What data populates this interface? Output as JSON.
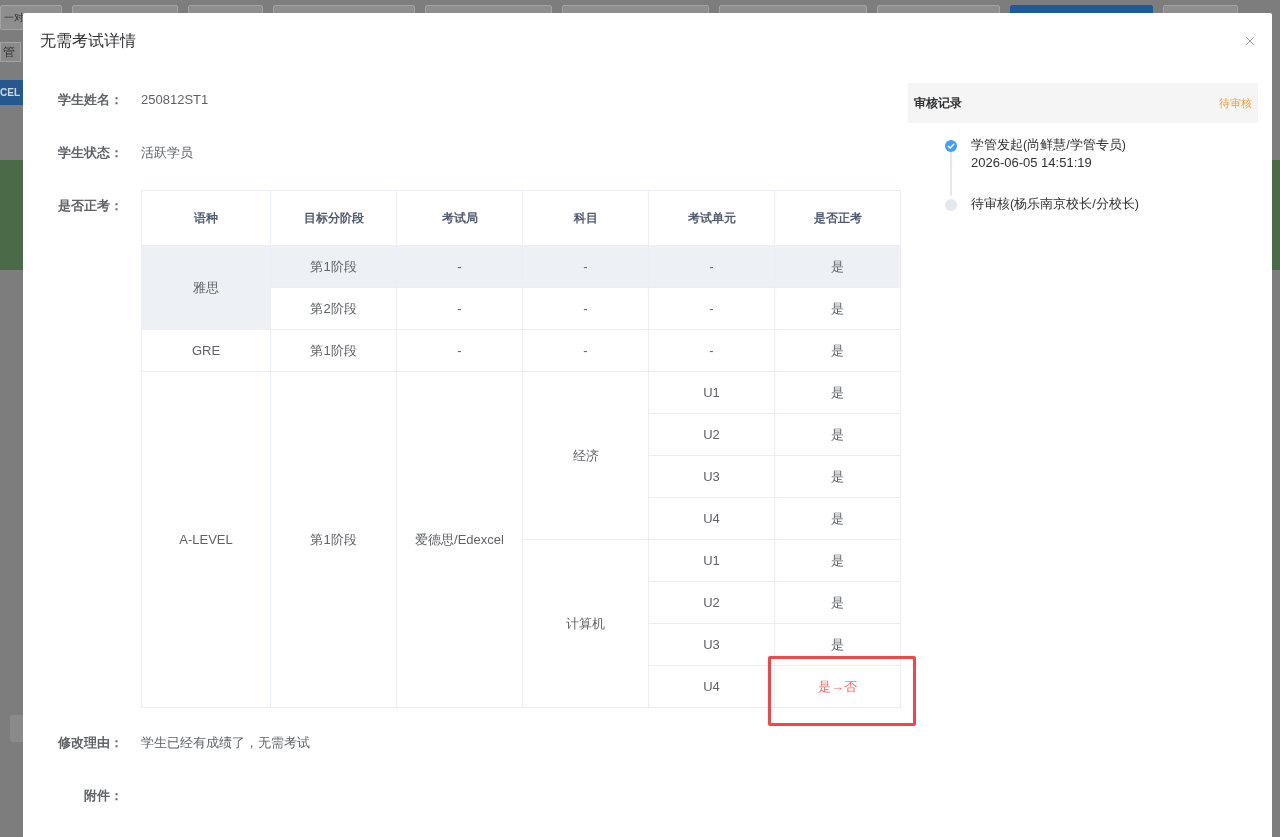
{
  "background": {
    "tabs": [
      {
        "label": "一对",
        "selected": false
      },
      {
        "selected": false
      },
      {
        "selected": false
      },
      {
        "selected": false
      },
      {
        "selected": false
      },
      {
        "selected": false
      },
      {
        "selected": false
      },
      {
        "selected": false
      },
      {
        "selected": true
      },
      {
        "selected": false
      }
    ],
    "toolbar_button": "管",
    "export_button": "CEL"
  },
  "dialog": {
    "title": "无需考试详情",
    "fields": [
      {
        "kind": "text",
        "label": "学生姓名：",
        "value": "250812ST1"
      },
      {
        "kind": "text",
        "label": "学生状态：",
        "value": "活跃学员"
      },
      {
        "kind": "table",
        "label": "是否正考：",
        "table": {
          "columns": [
            "语种",
            "目标分阶段",
            "考试局",
            "科目",
            "考试单元",
            "是否正考"
          ],
          "languages": [
            {
              "name": "雅思",
              "stages": [
                {
                  "name": "第1阶段",
                  "board": "-",
                  "subjects": [
                    {
                      "name": "-",
                      "units": [
                        {
                          "name": "-",
                          "formal": "是",
                          "hovered": true,
                          "changed": false
                        }
                      ]
                    }
                  ]
                },
                {
                  "name": "第2阶段",
                  "board": "-",
                  "subjects": [
                    {
                      "name": "-",
                      "units": [
                        {
                          "name": "-",
                          "formal": "是",
                          "hovered": false,
                          "changed": false
                        }
                      ]
                    }
                  ]
                }
              ]
            },
            {
              "name": "GRE",
              "stages": [
                {
                  "name": "第1阶段",
                  "board": "-",
                  "subjects": [
                    {
                      "name": "-",
                      "units": [
                        {
                          "name": "-",
                          "formal": "是",
                          "hovered": false,
                          "changed": false
                        }
                      ]
                    }
                  ]
                }
              ]
            },
            {
              "name": "A-LEVEL",
              "stages": [
                {
                  "name": "第1阶段",
                  "board": "爱德思/Edexcel",
                  "subjects": [
                    {
                      "name": "经济",
                      "units": [
                        {
                          "name": "U1",
                          "formal": "是",
                          "hovered": false,
                          "changed": false
                        },
                        {
                          "name": "U2",
                          "formal": "是",
                          "hovered": false,
                          "changed": false
                        },
                        {
                          "name": "U3",
                          "formal": "是",
                          "hovered": false,
                          "changed": false
                        },
                        {
                          "name": "U4",
                          "formal": "是",
                          "hovered": false,
                          "changed": false
                        }
                      ]
                    },
                    {
                      "name": "计算机",
                      "units": [
                        {
                          "name": "U1",
                          "formal": "是",
                          "hovered": false,
                          "changed": false
                        },
                        {
                          "name": "U2",
                          "formal": "是",
                          "hovered": false,
                          "changed": false
                        },
                        {
                          "name": "U3",
                          "formal": "是",
                          "hovered": false,
                          "changed": false
                        },
                        {
                          "name": "U4",
                          "formal": "是→否",
                          "hovered": false,
                          "changed": true
                        }
                      ]
                    }
                  ]
                }
              ]
            }
          ]
        }
      },
      {
        "kind": "text",
        "label": "修改理由：",
        "value": "学生已经有成绩了，无需考试"
      },
      {
        "kind": "text",
        "label": "附件："
      }
    ],
    "review": {
      "title": "审核记录",
      "status": "待审核",
      "steps": [
        {
          "kind": "done",
          "title": "学管发起(尚鲜慧/学管专员)",
          "time": "2026-06-05 14:51:19"
        },
        {
          "kind": "pending",
          "title": "待审核(杨乐南京校长/分校长)"
        }
      ]
    }
  }
}
